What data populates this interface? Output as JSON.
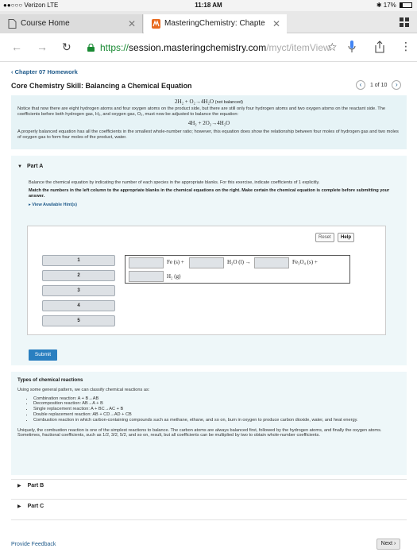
{
  "status": {
    "carrier": "●●○○○ Verizon  LTE",
    "time": "11:18 AM",
    "battery": "17%"
  },
  "tabs": [
    {
      "label": "Course Home"
    },
    {
      "label": "MasteringChemistry: Chapte"
    }
  ],
  "address": {
    "scheme": "https://",
    "host": "session.masteringchemistry.com",
    "path": "/myct/itemView"
  },
  "page": {
    "breadcrumb": "Chapter 07 Homework",
    "title": "Core Chemistry Skill: Balancing a Chemical Equation",
    "pager": "1 of 10",
    "intro": {
      "eq1": "2H₂ + O₂→4H₂O",
      "eq1_note": "(not balanced)",
      "p1": "Notice that now there are eight hydrogen atoms and four oxygen atoms on the product side, but there are still only four hydrogen atoms and two oxygen atoms on the reactant side. The coefficients before both hydrogen gas, H₂, and oxygen gas, O₂, must now be adjusted to balance the equation:",
      "eq2": "4H₂ + 2O₂→4H₂O",
      "p2": "A properly balanced equation has all the coefficients in the smallest whole-number ratio; however, this equation does show the relationship between four moles of hydrogen gas and two moles of oxygen gas to form four moles of the product, water."
    },
    "partA": {
      "label": "Part A",
      "instructions": "Balance the chemical equation by indicating the number of each species in the appropriate blanks. For this exercise, indicate coefficients of 1 explicitly.",
      "bold": "Match the numbers in the left column to the appropriate blanks in the chemical equations on the right. Make certain the chemical equation is complete before submitting your answer.",
      "hints": "View Available Hint(s)",
      "reset": "Reset",
      "help": "Help",
      "coefficients": [
        "1",
        "2",
        "3",
        "4",
        "5"
      ],
      "species": {
        "fe": "Fe (s) +",
        "h2o": "H₂O (l) →",
        "fe3o4": "Fe₃O₄ (s) +",
        "h2": "H₂ (g)"
      },
      "submit": "Submit"
    },
    "types": {
      "heading": "Types of chemical reactions",
      "lead": "Using some general pattern, we can classify chemical reactions as:",
      "items": [
        "Combination reaction: A + B→AB",
        "Decomposition reaction: AB→A + B",
        "Single replacement reaction: A + BC→AC + B",
        "Double replacement reaction: AB + CD→AD + CB",
        "Combustion reaction in which carbon-containing compounds such as methane, ethane, and so on, burn in oxygen to produce carbon dioxide, water, and heat energy."
      ],
      "closing": "Uniquely, the combustion reaction is one of the simplest reactions to balance. The carbon atoms are always balanced first, followed by the hydrogen atoms, and finally the oxygen atoms. Sometimes, fractional coefficients, such as 1/2, 3/2, 5/2, and so on, result, but all coefficients can be multiplied by two to obtain whole-number coefficients."
    },
    "partB": "Part B",
    "partC": "Part C",
    "feedback": "Provide Feedback",
    "next": "Next"
  }
}
